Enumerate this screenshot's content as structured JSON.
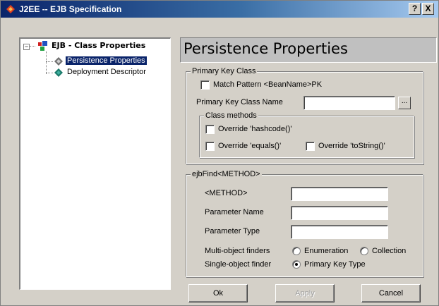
{
  "window": {
    "title": "J2EE -- EJB Specification",
    "help_label": "?",
    "close_label": "X"
  },
  "tree": {
    "root_label": "EJB - Class Properties",
    "expander": "−",
    "items": [
      {
        "label": "Persistence Properties",
        "selected": true
      },
      {
        "label": "Deployment Descriptor",
        "selected": false
      }
    ]
  },
  "page_title": "Persistence Properties",
  "primary_key": {
    "legend": "Primary Key Class",
    "match_pattern_label": "Match Pattern <BeanName>PK",
    "match_pattern_checked": false,
    "class_name_label": "Primary Key Class Name",
    "class_name_value": "",
    "browse_label": "...",
    "class_methods": {
      "legend": "Class methods",
      "hashcode_label": "Override 'hashcode()'",
      "equals_label": "Override 'equals()'",
      "tostring_label": "Override 'toString()'"
    }
  },
  "finder": {
    "legend": "ejbFind<METHOD>",
    "method_label": "<METHOD>",
    "method_value": "",
    "param_name_label": "Parameter Name",
    "param_name_value": "",
    "param_type_label": "Parameter Type",
    "param_type_value": "",
    "multi_label": "Multi-object finders",
    "enumeration_label": "Enumeration",
    "collection_label": "Collection",
    "single_label": "Single-object finder",
    "primary_key_type_label": "Primary Key Type",
    "single_selected": "Primary Key Type"
  },
  "buttons": {
    "ok": "Ok",
    "apply": "Apply",
    "cancel": "Cancel"
  },
  "colors": {
    "titlebar_start": "#0a246a",
    "titlebar_end": "#a6caf0",
    "selection": "#0a246a",
    "face": "#d4d0c8"
  }
}
